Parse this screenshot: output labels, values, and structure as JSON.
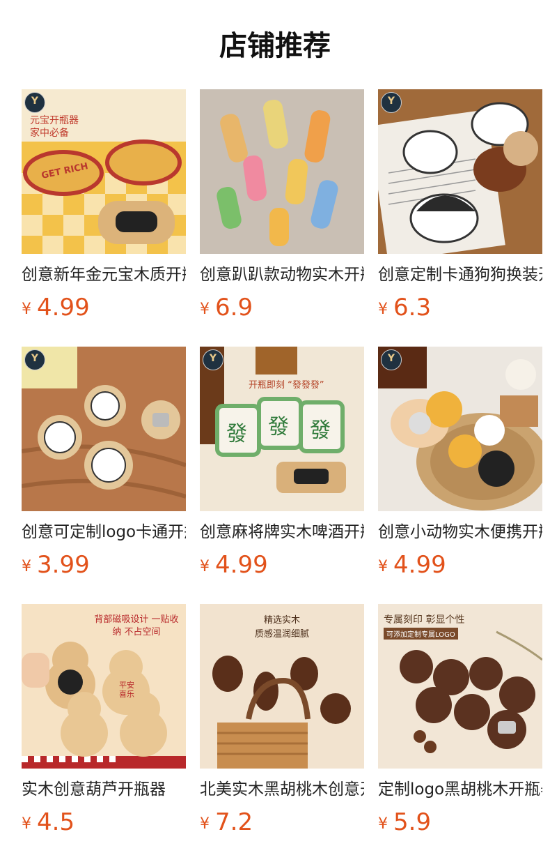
{
  "page_title": "店铺推荐",
  "products": [
    {
      "name": "创意新年金元宝木质开瓶器",
      "currency": "¥",
      "price": "4.99",
      "scene": "gold"
    },
    {
      "name": "创意趴趴款动物实木开瓶器",
      "currency": "¥",
      "price": "6.9",
      "scene": "animals"
    },
    {
      "name": "创意定制卡通狗狗换装开瓶器",
      "currency": "¥",
      "price": "6.3",
      "scene": "dogs"
    },
    {
      "name": "创意可定制logo卡通开瓶器",
      "currency": "¥",
      "price": "3.99",
      "scene": "cartoon"
    },
    {
      "name": "创意麻将牌实木啤酒开瓶器",
      "currency": "¥",
      "price": "4.99",
      "scene": "mahjong"
    },
    {
      "name": "创意小动物实木便携开瓶器",
      "currency": "¥",
      "price": "4.99",
      "scene": "small-animals"
    },
    {
      "name": "实木创意葫芦开瓶器",
      "currency": "¥",
      "price": "4.5",
      "scene": "gourd"
    },
    {
      "name": "北美实木黑胡桃木创意开瓶器",
      "currency": "¥",
      "price": "7.2",
      "scene": "walnut-knob"
    },
    {
      "name": "定制logo黑胡桃木开瓶器",
      "currency": "¥",
      "price": "5.9",
      "scene": "walnut-coaster"
    }
  ],
  "image_texts": {
    "gold_banner": "元宝开瓶器 家中必备",
    "gold_badge": "GET RICH",
    "mahjong_banner": "开瓶即刻 “發發發”",
    "mahjong_tile": "發",
    "gourd_banner": "背部磁吸设计 一贴收纳 不占空间",
    "gourd_char": "平安喜乐",
    "walnut_banner_1": "精选实木",
    "walnut_banner_2": "质感温润细腻",
    "coaster_banner": "专属刻印 彰显个性",
    "coaster_sub": "可添加定制专属LOGO"
  },
  "colors": {
    "price": "#e2521b",
    "title": "#111111",
    "name": "#222222"
  }
}
